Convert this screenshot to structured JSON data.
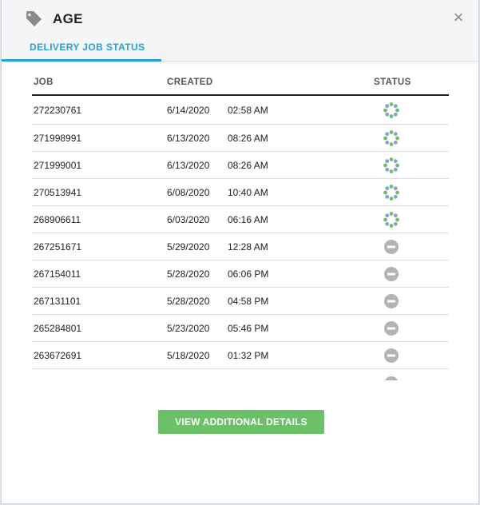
{
  "header": {
    "title": "AGE",
    "tab_label": "DELIVERY JOB STATUS",
    "close_glyph": "×"
  },
  "table": {
    "columns": [
      "JOB",
      "CREATED",
      "STATUS"
    ],
    "rows": [
      {
        "job": "272230761",
        "date": "6/14/2020",
        "time": "02:58 AM",
        "status": "in-progress-spinner-icon"
      },
      {
        "job": "271998991",
        "date": "6/13/2020",
        "time": "08:26 AM",
        "status": "in-progress-spinner-icon"
      },
      {
        "job": "271999001",
        "date": "6/13/2020",
        "time": "08:26 AM",
        "status": "in-progress-spinner-icon"
      },
      {
        "job": "270513941",
        "date": "6/08/2020",
        "time": "10:40 AM",
        "status": "in-progress-spinner-icon"
      },
      {
        "job": "268906611",
        "date": "6/03/2020",
        "time": "06:16 AM",
        "status": "in-progress-spinner-icon"
      },
      {
        "job": "267251671",
        "date": "5/29/2020",
        "time": "12:28 AM",
        "status": "canceled-minus-icon"
      },
      {
        "job": "267154011",
        "date": "5/28/2020",
        "time": "06:06 PM",
        "status": "canceled-minus-icon"
      },
      {
        "job": "267131101",
        "date": "5/28/2020",
        "time": "04:58 PM",
        "status": "canceled-minus-icon"
      },
      {
        "job": "265284801",
        "date": "5/23/2020",
        "time": "05:46 PM",
        "status": "canceled-minus-icon"
      },
      {
        "job": "263672691",
        "date": "5/18/2020",
        "time": "01:32 PM",
        "status": "canceled-minus-icon"
      }
    ]
  },
  "button": {
    "view_details_label": "VIEW ADDITIONAL DETAILS"
  },
  "colors": {
    "accent": "#2a9fd6",
    "button": "#6cc068",
    "spinner_green": "#6cc068",
    "spinner_blue": "#8aa0cc",
    "canceled": "#b3b3b3"
  }
}
